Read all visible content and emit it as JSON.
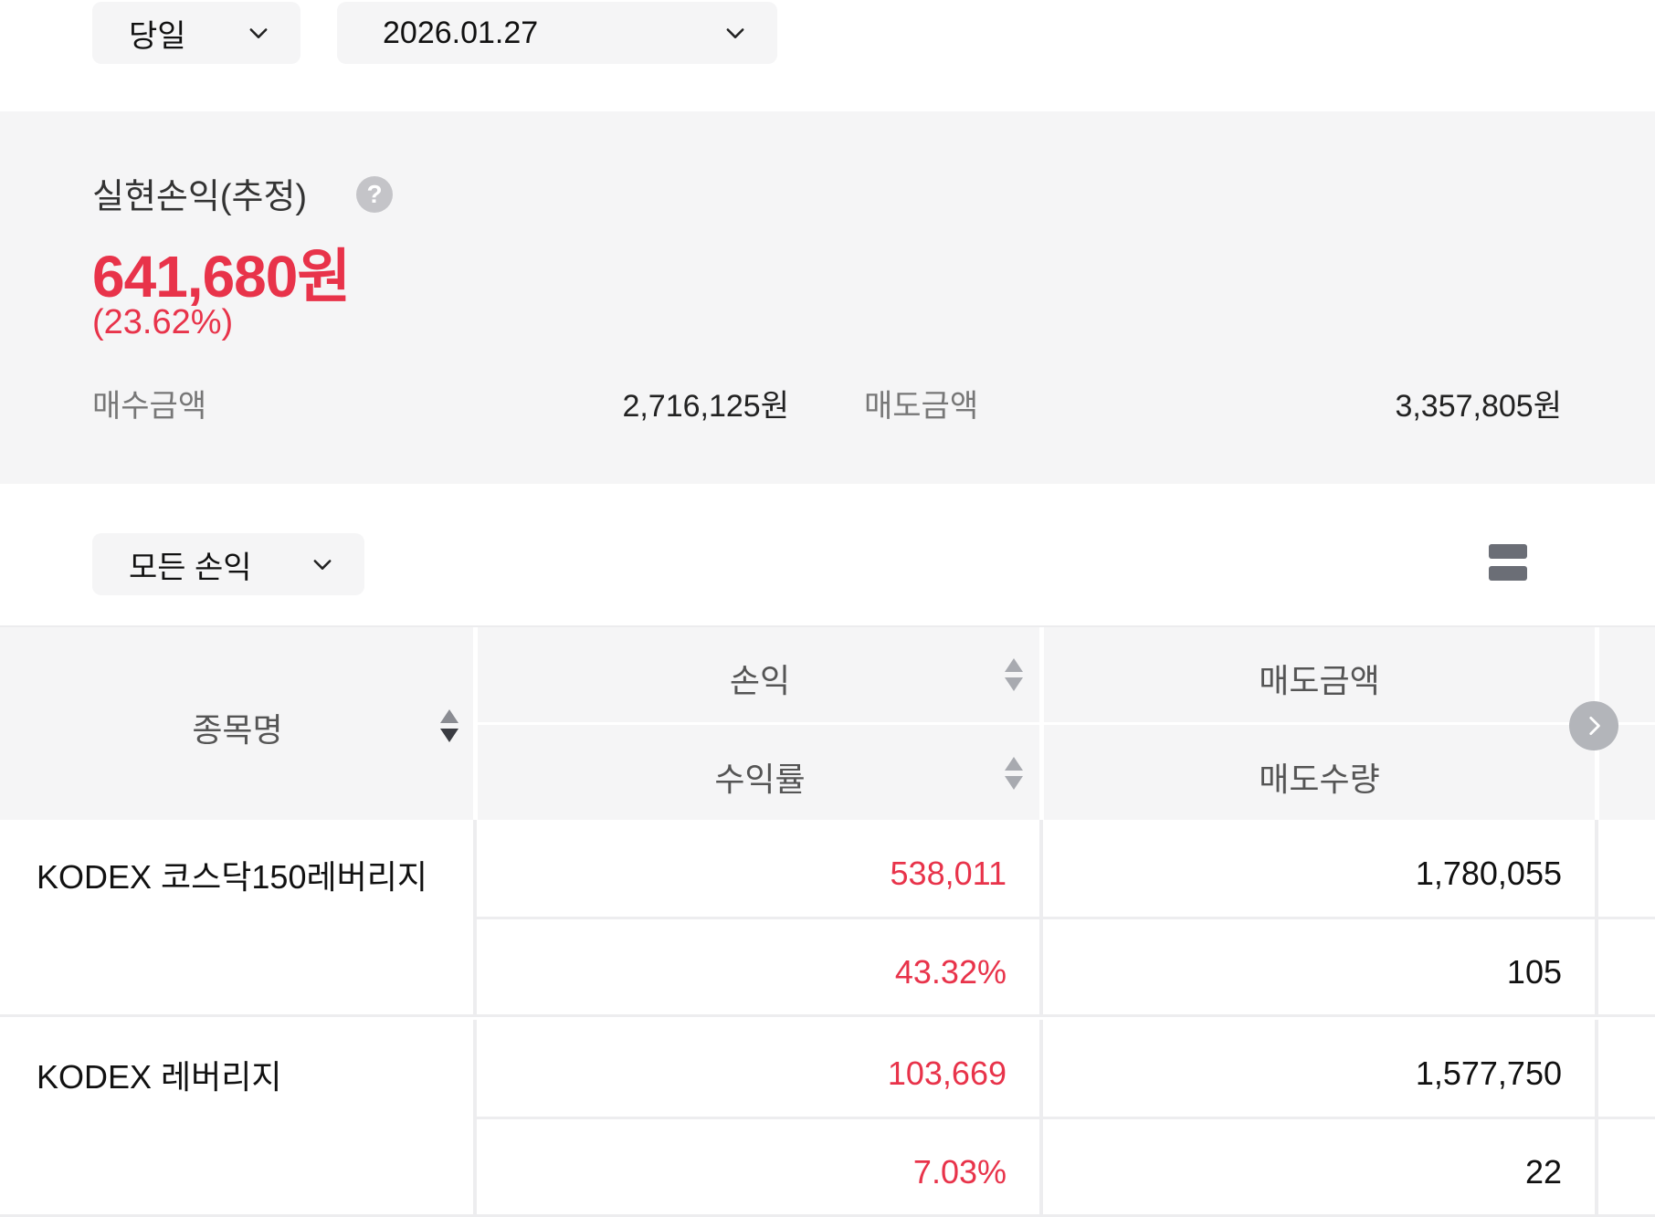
{
  "filters": {
    "period": "당일",
    "date": "2026.01.27",
    "profit_type": "모든 손익"
  },
  "summary": {
    "title": "실현손익(추정)",
    "help": "?",
    "amount": "641,680원",
    "rate": "(23.62%)",
    "buy_label": "매수금액",
    "buy_value": "2,716,125원",
    "sell_label": "매도금액",
    "sell_value": "3,357,805원"
  },
  "table": {
    "headers": {
      "name": "종목명",
      "profit": "손익",
      "rate": "수익률",
      "sell_amount": "매도금액",
      "sell_qty": "매도수량"
    },
    "rows": [
      {
        "name": "KODEX 코스닥150레버리지",
        "profit": "538,011",
        "rate": "43.32%",
        "sell_amount": "1,780,055",
        "sell_qty": "105"
      },
      {
        "name": "KODEX 레버리지",
        "profit": "103,669",
        "rate": "7.03%",
        "sell_amount": "1,577,750",
        "sell_qty": "22"
      }
    ]
  },
  "colors": {
    "accent_red": "#e8334a",
    "panel_bg": "#f5f5f6"
  }
}
